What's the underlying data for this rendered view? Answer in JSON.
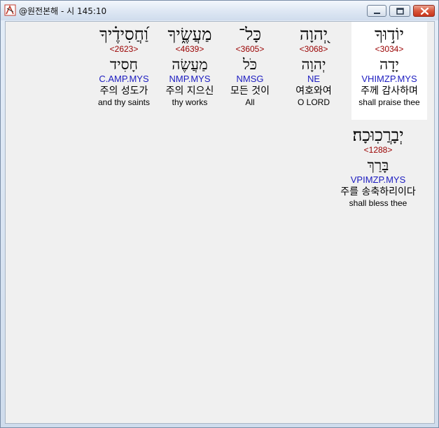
{
  "window": {
    "title": "@원전본해 - 시 145:10"
  },
  "words": [
    {
      "hebrew": "יוֹד֣וּךָ",
      "strong": "<3034>",
      "lemma": "יָדָה",
      "morph": "VHIMZP.MYS",
      "korean": "주께 감사하며",
      "english": "shall praise thee"
    },
    {
      "hebrew": "יְ֭הוָה",
      "strong": "<3068>",
      "lemma": "יְהוָה",
      "morph": "NE",
      "korean": "여호와여",
      "english": "O LORD"
    },
    {
      "hebrew": "כָּל־",
      "strong": "<3605>",
      "lemma": "כֹּל",
      "morph": "NMSG",
      "korean": "모든 것이",
      "english": "All"
    },
    {
      "hebrew": "מַעֲשֶׂ֑יךָ",
      "strong": "<4639>",
      "lemma": "מַעֲשֶׂה",
      "morph": "NMP.MYS",
      "korean": "주의 지으신",
      "english": "thy works"
    },
    {
      "hebrew": "וַ֝חֲסִידֶ֗יךָ",
      "strong": "<2623>",
      "lemma": "חָסִיד",
      "morph": "C.AMP.MYS",
      "korean": "주의 성도가",
      "english": "and thy saints"
    },
    {
      "hebrew": "יְבָרֲכֽוּכָה׃",
      "strong": "<1288>",
      "lemma": "בָּרַךְ",
      "morph": "VPIMZP.MYS",
      "korean": "주를 송축하리이다",
      "english": "shall bless thee"
    }
  ]
}
